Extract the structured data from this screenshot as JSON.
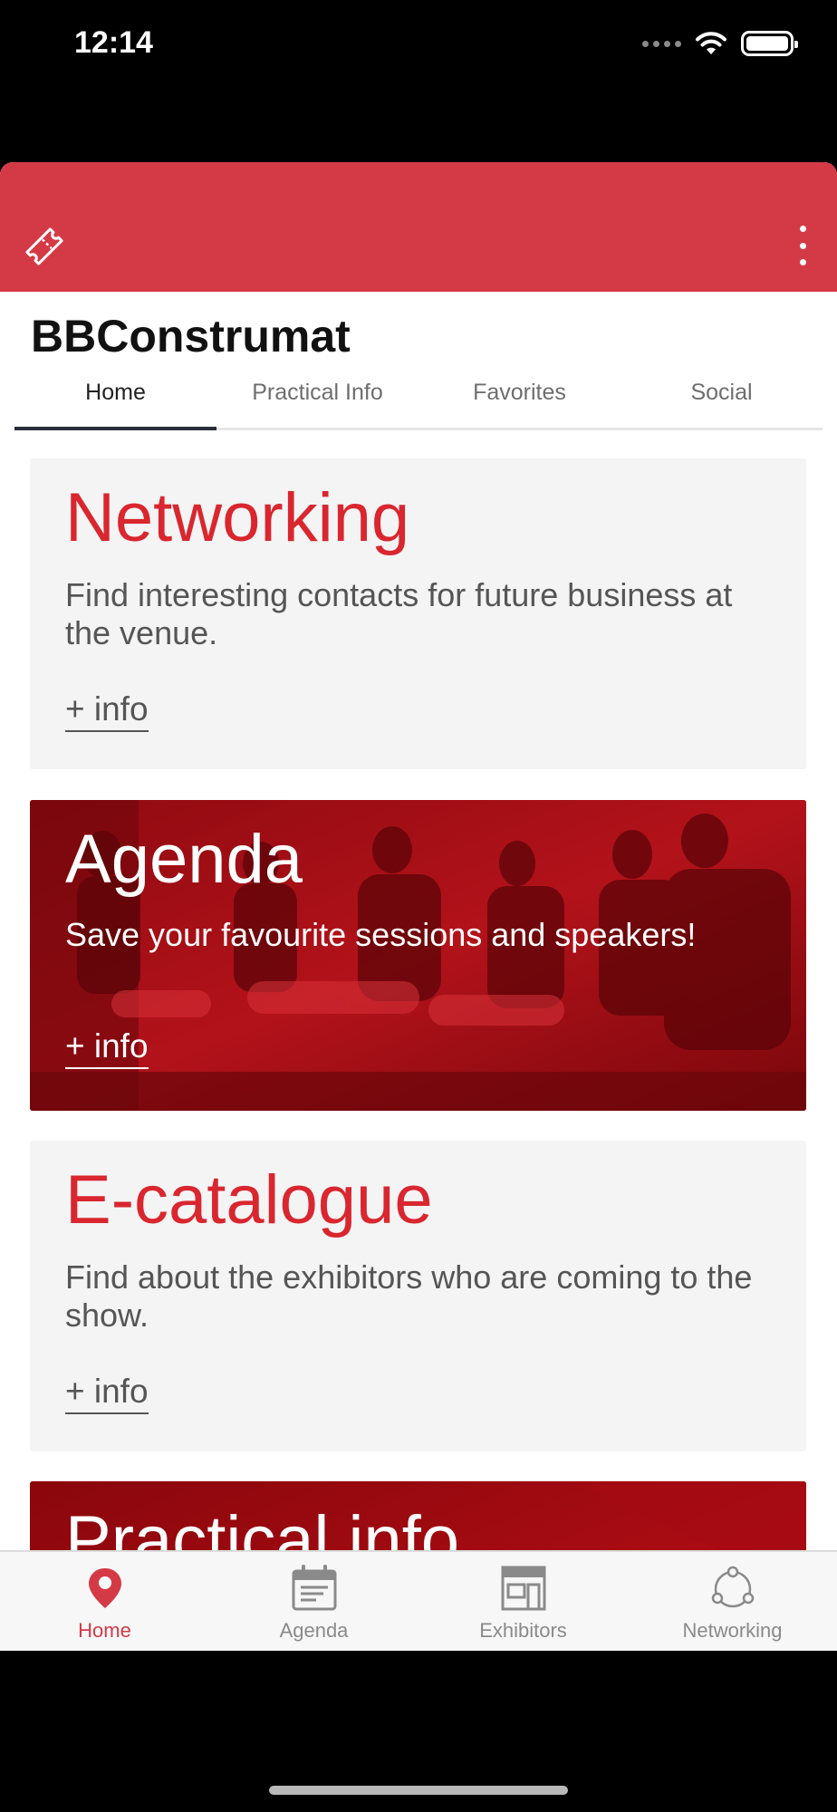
{
  "status_bar": {
    "time": "12:14"
  },
  "header": {
    "app_title": "BBConstrumat"
  },
  "colors": {
    "accent": "#d43a46",
    "card_title_red": "#d9262f",
    "card_dark_bg": "#b10b14"
  },
  "tabs": [
    {
      "label": "Home",
      "active": true
    },
    {
      "label": "Practical Info",
      "active": false
    },
    {
      "label": "Favorites",
      "active": false
    },
    {
      "label": "Social",
      "active": false
    }
  ],
  "cards": [
    {
      "title": "Networking",
      "description": "Find interesting contacts for future business at the venue.",
      "more": "+ info"
    },
    {
      "title": "Agenda",
      "description": "Save your favourite sessions and speakers!",
      "more": "+ info"
    },
    {
      "title": "E-catalogue",
      "description": "Find about the exhibitors who are coming to the show.",
      "more": "+ info"
    },
    {
      "title": "Practical info"
    }
  ],
  "bottom_nav": [
    {
      "label": "Home",
      "icon": "location-pin-icon",
      "active": true
    },
    {
      "label": "Agenda",
      "icon": "calendar-icon",
      "active": false
    },
    {
      "label": "Exhibitors",
      "icon": "storefront-icon",
      "active": false
    },
    {
      "label": "Networking",
      "icon": "network-icon",
      "active": false
    }
  ]
}
